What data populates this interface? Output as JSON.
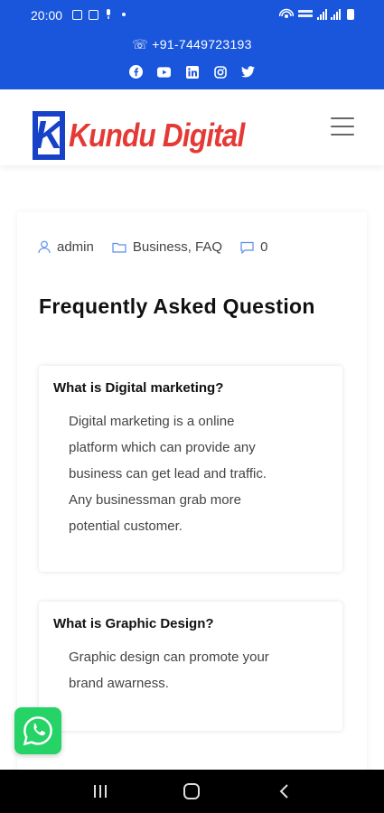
{
  "status_bar": {
    "time": "20:00"
  },
  "topbar": {
    "phone": "☏ +91-7449723193",
    "social_icons": [
      "facebook-icon",
      "youtube-icon",
      "linkedin-icon",
      "instagram-icon",
      "twitter-icon"
    ],
    "background": "#1a56db"
  },
  "header": {
    "logo_letter": "K",
    "logo_text": "Kundu Digital",
    "logo_blue": "#1742c7",
    "logo_red": "#e53935"
  },
  "post": {
    "author": "admin",
    "categories": "Business, FAQ",
    "comments": "0",
    "title": "Frequently Asked Question",
    "faqs": [
      {
        "question": "What is Digital marketing?",
        "answer_lines": [
          "Digital marketing is a online",
          "platform which can provide any",
          "business can get lead and traffic.",
          "Any businessman grab more",
          "potential customer."
        ]
      },
      {
        "question": "What is Graphic Design?",
        "answer_lines": [
          "Graphic design can promote your",
          "brand awarness."
        ]
      }
    ]
  },
  "floating": {
    "whatsapp_icon": "whatsapp-icon",
    "color": "#25d366"
  },
  "navbar": {
    "buttons": [
      "recent-apps-icon",
      "home-icon",
      "back-icon"
    ]
  }
}
